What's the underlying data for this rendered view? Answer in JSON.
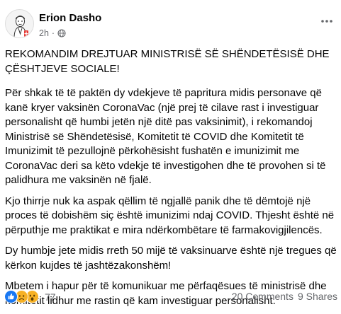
{
  "post": {
    "author": "Erion Dasho",
    "time": "2h",
    "separator": "·",
    "title": "REKOMANDIM DREJTUAR MINISTRISË SË SHËNDETËSISË DHE ÇËSHTJEVE SOCIALE!",
    "paragraphs": [
      "Për shkak të të paktën dy vdekjeve të papritura midis personave që kanë kryer vaksinën CoronaVac (një prej të cilave rast i investiguar personalisht që humbi jetën një ditë pas vaksinimit), i rekomandoj Ministrisë së Shëndetësisë, Komitetit të COVID dhe Komitetit të Imunizimit të pezullojnë përkohësisht fushatën e imunizimit me CoronaVac deri sa këto vdekje të investigohen dhe të provohen si të palidhura me vaksinën në fjalë.",
      "Kjo thirrje nuk ka aspak qëllim të ngjallë panik dhe të dëmtojë një proces të dobishëm siç është imunizimi ndaj COVID. Thjesht është në përputhje me praktikat e mira ndërkombëtare të farmakovigjilencës.",
      "Dy humbje jete midis rreth 50 mijë të vaksinuarve është një tregues që kërkon kujdes të jashtëzakonshëm!",
      "Mbetem i hapur për të komunikuar me përfaqësues të ministrisë dhe komitetit lidhur me rastin që kam investiguar personalisht."
    ]
  },
  "reactions": {
    "types": [
      "like-icon",
      "sad-icon",
      "wow-icon"
    ],
    "count": "77",
    "comments": "20 Comments",
    "shares": "9 Shares"
  }
}
